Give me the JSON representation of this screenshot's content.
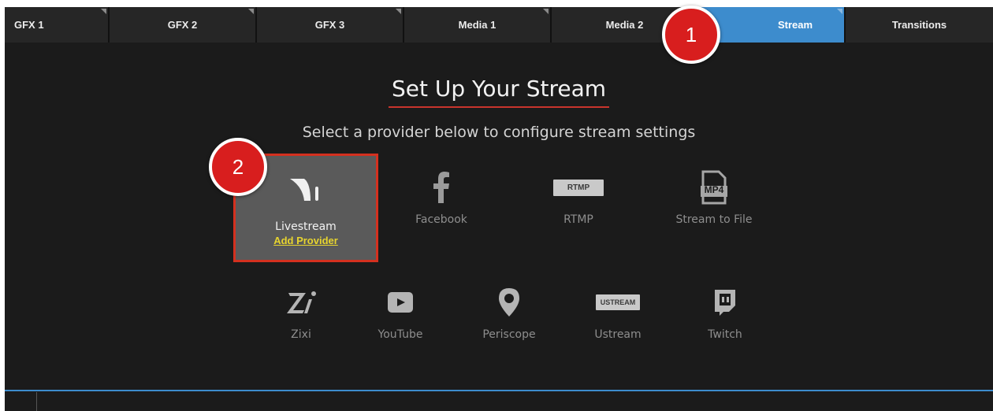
{
  "tabs": [
    {
      "label": "GFX 1",
      "active": false
    },
    {
      "label": "GFX 2",
      "active": false
    },
    {
      "label": "GFX 3",
      "active": false
    },
    {
      "label": "Media 1",
      "active": false
    },
    {
      "label": "Media 2",
      "active": false
    },
    {
      "label": "Stream",
      "active": true
    },
    {
      "label": "Transitions",
      "active": false
    }
  ],
  "main": {
    "title": "Set Up Your Stream",
    "subtitle": "Select a provider below to configure stream settings"
  },
  "providers_row1": [
    {
      "name": "Livestream",
      "icon": "livestream-icon",
      "action": "Add Provider",
      "selected": true
    },
    {
      "name": "Facebook",
      "icon": "facebook-icon"
    },
    {
      "name": "RTMP",
      "icon": "rtmp-icon",
      "badge": "RTMP"
    },
    {
      "name": "Stream to File",
      "icon": "mp4-file-icon",
      "badge": "MP4"
    }
  ],
  "providers_row2": [
    {
      "name": "Zixi",
      "icon": "zixi-icon"
    },
    {
      "name": "YouTube",
      "icon": "youtube-icon"
    },
    {
      "name": "Periscope",
      "icon": "periscope-icon"
    },
    {
      "name": "Ustream",
      "icon": "ustream-icon",
      "badge": "USTREAM"
    },
    {
      "name": "Twitch",
      "icon": "twitch-icon"
    }
  ],
  "callouts": [
    "1",
    "2"
  ],
  "colors": {
    "background": "#1b1b1b",
    "tab": "#262626",
    "active_tab": "#3d8ccd",
    "title_underline": "#c9342c",
    "selected_border": "#d4301f",
    "add_provider": "#e7d42f",
    "callout": "#d81e1e"
  }
}
